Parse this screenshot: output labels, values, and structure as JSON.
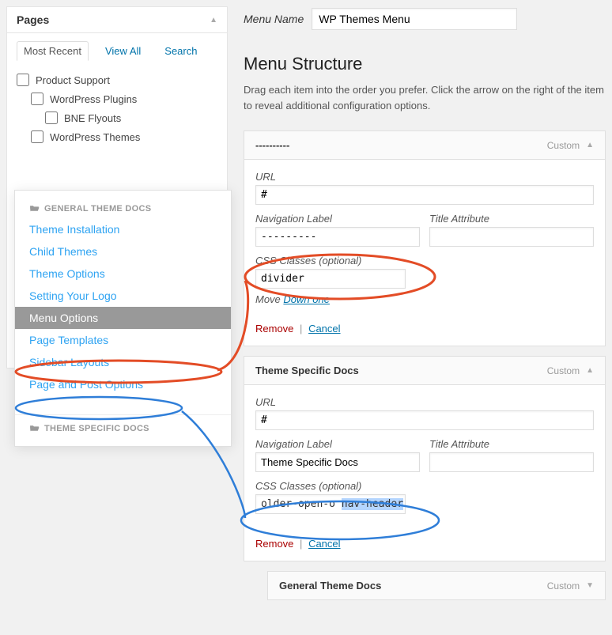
{
  "left": {
    "title": "Pages",
    "tabs": {
      "recent": "Most Recent",
      "view_all": "View All",
      "search": "Search"
    },
    "items": [
      {
        "label": "Product Support",
        "indent": 0
      },
      {
        "label": "WordPress Plugins",
        "indent": 1
      },
      {
        "label": "BNE Flyouts",
        "indent": 2
      },
      {
        "label": "WordPress Themes",
        "indent": 1
      }
    ]
  },
  "popup": {
    "header1": "GENERAL THEME DOCS",
    "items": [
      "Theme Installation",
      "Child Themes",
      "Theme Options",
      "Setting Your Logo",
      "Menu Options",
      "Page Templates",
      "Sidebar Layouts",
      "Page and Post Options"
    ],
    "header2": "THEME SPECIFIC DOCS"
  },
  "right": {
    "menu_name_label": "Menu Name",
    "menu_name_value": "WP Themes Menu",
    "structure_heading": "Menu Structure",
    "structure_desc": "Drag each item into the order you prefer. Click the arrow on the right of the item to reveal additional configuration options.",
    "url_label": "URL",
    "nav_label": "Navigation Label",
    "title_attr_label": "Title Attribute",
    "css_label": "CSS Classes (optional)",
    "move_text": "Move",
    "move_link": "Down one",
    "remove": "Remove",
    "cancel": "Cancel",
    "type_custom": "Custom",
    "item1": {
      "title": "----------",
      "url": "#",
      "nav_value": "---------",
      "title_value": "",
      "css_value": "divider"
    },
    "item2": {
      "title": "Theme Specific Docs",
      "url": "#",
      "nav_value": "Theme Specific Docs",
      "title_value": "",
      "css_prefix": "older-open-o ",
      "css_highlight": "nav-header"
    },
    "item3": {
      "title": "General Theme Docs"
    }
  }
}
